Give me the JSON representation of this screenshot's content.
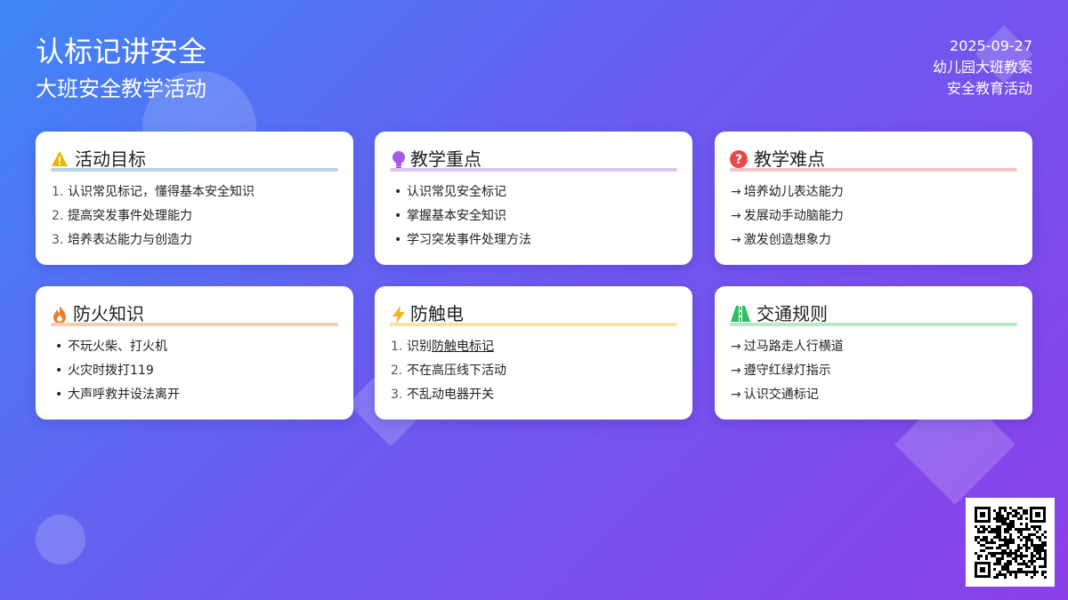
{
  "header": {
    "title": "认标记讲安全",
    "subtitle": "大班安全教学活动",
    "date": "2025-09-27",
    "class_name": "幼儿园大班教案",
    "category": "安全教育活动"
  },
  "cards": [
    {
      "title": "活动目标",
      "icon": "warning-icon",
      "accent": "#b7d3ea",
      "list_style": "ordered",
      "items": [
        "认识常见标记，懂得基本安全知识",
        "提高突发事件处理能力",
        "培养表达能力与创造力"
      ]
    },
    {
      "title": "教学重点",
      "icon": "lightbulb-icon",
      "accent": "#dcc4f2",
      "list_style": "bullet",
      "items": [
        "认识常见安全标记",
        "掌握基本安全知识",
        "学习突发事件处理方法"
      ]
    },
    {
      "title": "教学难点",
      "icon": "question-icon",
      "accent": "#f2c4c9",
      "list_style": "arrow",
      "items": [
        "培养幼儿表达能力",
        "发展动手动脑能力",
        "激发创造想象力"
      ]
    },
    {
      "title": "防火知识",
      "icon": "fire-icon",
      "accent": "#f6ceb2",
      "list_style": "bullet",
      "items": [
        "不玩火柴、打火机",
        "火灾时拨打119",
        "大声呼救并设法离开"
      ]
    },
    {
      "title": "防触电",
      "icon": "lightning-icon",
      "accent": "#f5e4a3",
      "list_style": "ordered",
      "items_first_prefix": "识别",
      "items_first_link": "防触电标记",
      "items": [
        "识别防触电标记",
        "不在高压线下活动",
        "不乱动电器开关"
      ]
    },
    {
      "title": "交通规则",
      "icon": "road-icon",
      "accent": "#b8e9c9",
      "list_style": "arrow",
      "items": [
        "过马路走人行横道",
        "遵守红绿灯指示",
        "认识交通标记"
      ]
    }
  ],
  "markers": {
    "ordered": [
      "1.",
      "2.",
      "3."
    ],
    "bullet": "•",
    "arrow": "→"
  },
  "colors": {
    "bg_start": "#3f86f6",
    "bg_end": "#8b3fe8",
    "warning": "#f0b400",
    "lightbulb": "#a45be6",
    "question": "#e84848",
    "fire": "#f07a2a",
    "lightning": "#f2b51c",
    "road": "#2ebf62"
  }
}
